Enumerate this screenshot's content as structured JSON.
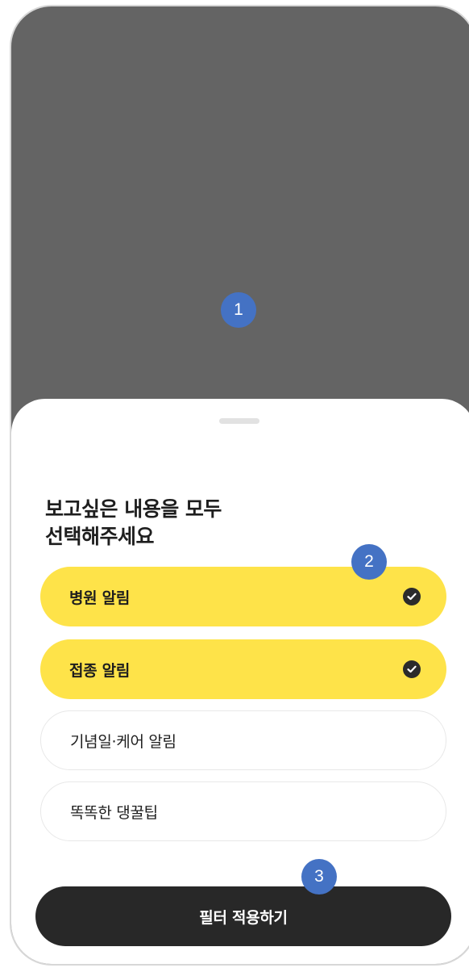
{
  "sheet": {
    "title_line1": "보고싶은 내용을 모두",
    "title_line2": "선택해주세요"
  },
  "options": [
    {
      "label": "병원 알림",
      "selected": true
    },
    {
      "label": "접종 알림",
      "selected": true
    },
    {
      "label": "기념일·케어 알림",
      "selected": false
    },
    {
      "label": "똑똑한 댕꿀팁",
      "selected": false
    }
  ],
  "apply_button": {
    "label": "필터 적용하기"
  },
  "markers": [
    "1",
    "2",
    "3"
  ],
  "colors": {
    "overlay": "#646464",
    "selected_fill": "#fee349",
    "button_fill": "#282828",
    "marker_fill": "#4472c4"
  },
  "icons": {
    "checked": "check-circle-icon"
  }
}
